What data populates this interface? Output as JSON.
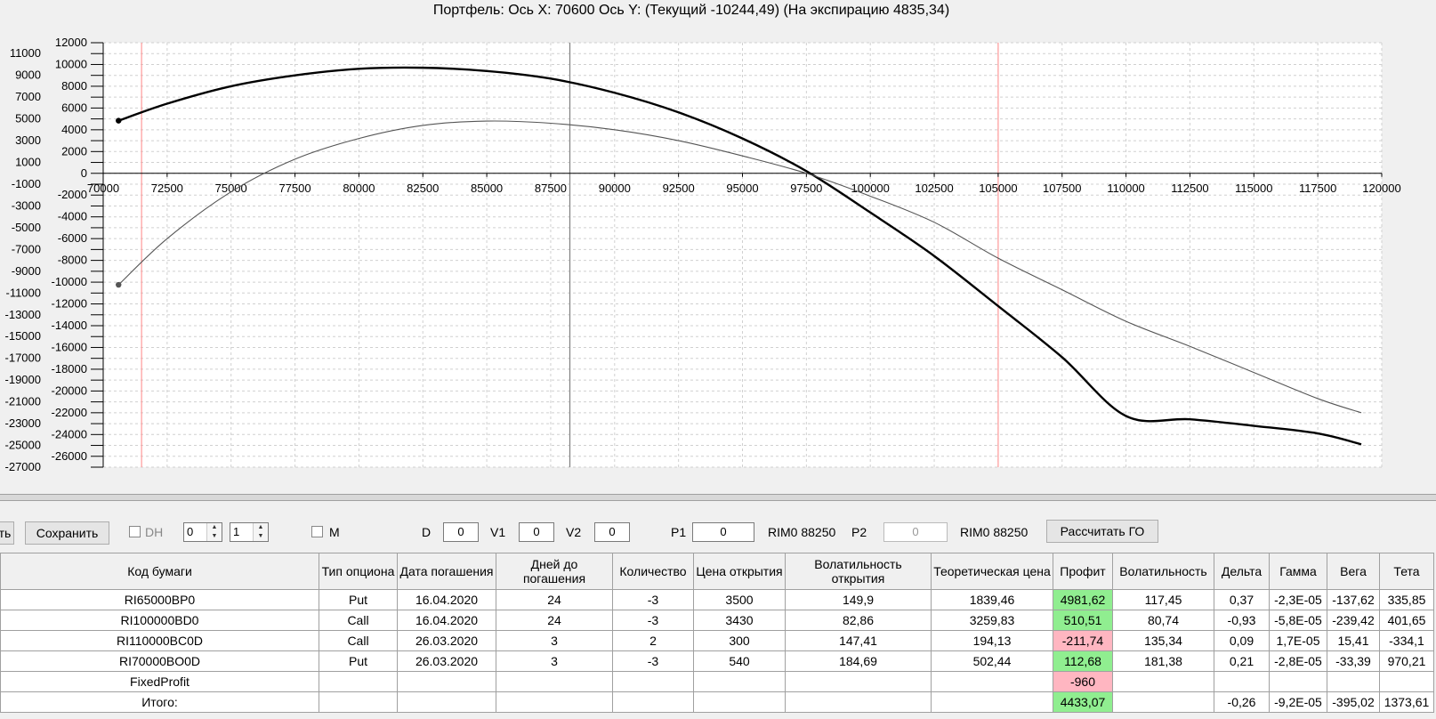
{
  "chart_data": {
    "type": "line",
    "title": "Портфель: Ось X: 70600 Ось Y:  (Текущий -10244,49)  (На экспирацию 4835,34)",
    "xlim": [
      70000,
      120000
    ],
    "ylim": [
      -27000,
      12000
    ],
    "x_ticks": [
      "70000",
      "72500",
      "75000",
      "77500",
      "80000",
      "82500",
      "85000",
      "87500",
      "90000",
      "92500",
      "95000",
      "97500",
      "100000",
      "102500",
      "105000",
      "107500",
      "110000",
      "112500",
      "115000",
      "117500",
      "120000"
    ],
    "y_ticks": [
      "12000",
      "11000",
      "10000",
      "9000",
      "8000",
      "7000",
      "6000",
      "5000",
      "4000",
      "3000",
      "2000",
      "1000",
      "0",
      "-1000",
      "-2000",
      "-3000",
      "-4000",
      "-5000",
      "-6000",
      "-7000",
      "-8000",
      "-9000",
      "-10000",
      "-11000",
      "-12000",
      "-13000",
      "-14000",
      "-15000",
      "-16000",
      "-17000",
      "-18000",
      "-19000",
      "-20000",
      "-21000",
      "-22000",
      "-23000",
      "-24000",
      "-25000",
      "-26000",
      "-27000"
    ],
    "grid": true,
    "vertical_markers": [
      {
        "x": 71500,
        "color": "#ff9999"
      },
      {
        "x": 88250,
        "color": "#808080"
      },
      {
        "x": 105000,
        "color": "#ff9999"
      }
    ],
    "series": [
      {
        "color": "#000000",
        "style": "bold",
        "x": [
          70600,
          72500,
          75000,
          77500,
          80000,
          82500,
          85000,
          87500,
          90000,
          92500,
          95000,
          97500,
          100000,
          102500,
          105000,
          107500,
          110000,
          112500,
          115000,
          117500,
          119200
        ],
        "y": [
          4835,
          6400,
          8000,
          9000,
          9600,
          9700,
          9400,
          8700,
          7400,
          5600,
          3200,
          200,
          -3600,
          -7600,
          -12200,
          -16900,
          -22300,
          -22600,
          -23200,
          -23900,
          -24900
        ]
      },
      {
        "color": "#555555",
        "style": "thin",
        "x": [
          70600,
          72500,
          75000,
          77500,
          80000,
          82500,
          85000,
          87500,
          90000,
          92500,
          95000,
          97500,
          100000,
          102500,
          105000,
          107500,
          110000,
          112500,
          115000,
          117500,
          119200
        ],
        "y": [
          -10244,
          -6000,
          -1700,
          1300,
          3200,
          4400,
          4800,
          4600,
          4000,
          3000,
          1600,
          0,
          -2100,
          -4500,
          -7800,
          -10700,
          -13600,
          -15900,
          -18300,
          -20700,
          -22000
        ]
      }
    ],
    "endpoint_markers": [
      {
        "x": 70600,
        "y": 4835
      },
      {
        "x": 70600,
        "y": -10244
      }
    ]
  },
  "toolbar": {
    "cut_button_label": "ть",
    "save_button_label": "Сохранить",
    "dh_label": "DH",
    "spin1_value": "0",
    "spin2_value": "1",
    "m_label": "M",
    "d_label": "D",
    "d_value": "0",
    "v1_label": "V1",
    "v1_value": "0",
    "v2_label": "V2",
    "v2_value": "0",
    "p1_label": "P1",
    "p1_value": "0",
    "p1_instrument": "RIM0 88250",
    "p2_label": "P2",
    "p2_value": "0",
    "p2_instrument": "RIM0 88250",
    "calc_button_label": "Рассчитать ГО"
  },
  "table": {
    "headers": [
      "Код бумаги",
      "Тип опциона",
      "Дата погашения",
      "Дней до погашения",
      "Количество",
      "Цена открытия",
      "Волатильность открытия",
      "Теоретическая цена",
      "Профит",
      "Волатильность",
      "Дельта",
      "Гамма",
      "Вега",
      "Тета"
    ],
    "rows": [
      {
        "code": "RI65000BP0",
        "type": "Put",
        "date": "16.04.2020",
        "days": "24",
        "qty": "-3",
        "open_price": "3500",
        "open_vol": "149,9",
        "theo": "1839,46",
        "profit": "4981,62",
        "profit_status": "pos",
        "vol": "117,45",
        "delta": "0,37",
        "gamma": "-2,3E-05",
        "vega": "-137,62",
        "theta": "335,85"
      },
      {
        "code": "RI100000BD0",
        "type": "Call",
        "date": "16.04.2020",
        "days": "24",
        "qty": "-3",
        "open_price": "3430",
        "open_vol": "82,86",
        "theo": "3259,83",
        "profit": "510,51",
        "profit_status": "pos",
        "vol": "80,74",
        "delta": "-0,93",
        "gamma": "-5,8E-05",
        "vega": "-239,42",
        "theta": "401,65"
      },
      {
        "code": "RI110000BC0D",
        "type": "Call",
        "date": "26.03.2020",
        "days": "3",
        "qty": "2",
        "open_price": "300",
        "open_vol": "147,41",
        "theo": "194,13",
        "profit": "-211,74",
        "profit_status": "neg",
        "vol": "135,34",
        "delta": "0,09",
        "gamma": "1,7E-05",
        "vega": "15,41",
        "theta": "-334,1"
      },
      {
        "code": "RI70000BO0D",
        "type": "Put",
        "date": "26.03.2020",
        "days": "3",
        "qty": "-3",
        "open_price": "540",
        "open_vol": "184,69",
        "theo": "502,44",
        "profit": "112,68",
        "profit_status": "pos",
        "vol": "181,38",
        "delta": "0,21",
        "gamma": "-2,8E-05",
        "vega": "-33,39",
        "theta": "970,21"
      },
      {
        "code": "FixedProfit",
        "type": "",
        "date": "",
        "days": "",
        "qty": "",
        "open_price": "",
        "open_vol": "",
        "theo": "",
        "profit": "-960",
        "profit_status": "neg",
        "vol": "",
        "delta": "",
        "gamma": "",
        "vega": "",
        "theta": ""
      },
      {
        "code": "Итого:",
        "type": "",
        "date": "",
        "days": "",
        "qty": "",
        "open_price": "",
        "open_vol": "",
        "theo": "",
        "profit": "4433,07",
        "profit_status": "pos",
        "vol": "",
        "delta": "-0,26",
        "gamma": "-9,2E-05",
        "vega": "-395,02",
        "theta": "1373,61"
      }
    ]
  },
  "colors": {
    "profit_positive": "#90ee90",
    "profit_negative": "#ffb6c1"
  }
}
